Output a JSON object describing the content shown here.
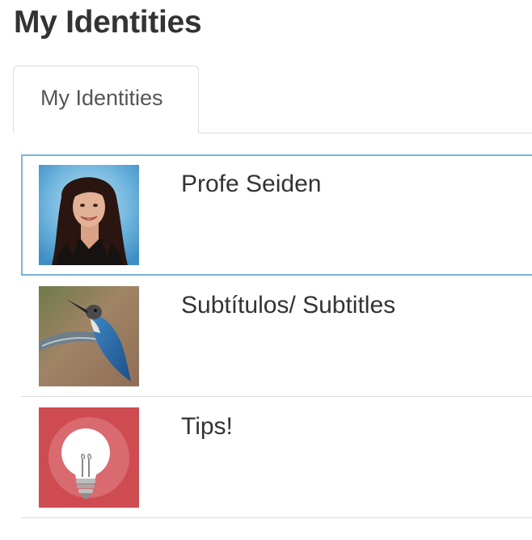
{
  "page": {
    "title": "My Identities"
  },
  "tabs": [
    {
      "label": "My Identities",
      "active": true
    }
  ],
  "identities": [
    {
      "name": "Profe Seiden",
      "avatar_icon": "portrait-photo",
      "selected": true
    },
    {
      "name": "Subtítulos/ Subtitles",
      "avatar_icon": "hummingbird-photo",
      "selected": false
    },
    {
      "name": "Tips!",
      "avatar_icon": "lightbulb-icon",
      "selected": false
    }
  ],
  "colors": {
    "selected_border": "#7ab2d8",
    "divider": "#dddddd",
    "tips_background": "#cf4b52"
  }
}
